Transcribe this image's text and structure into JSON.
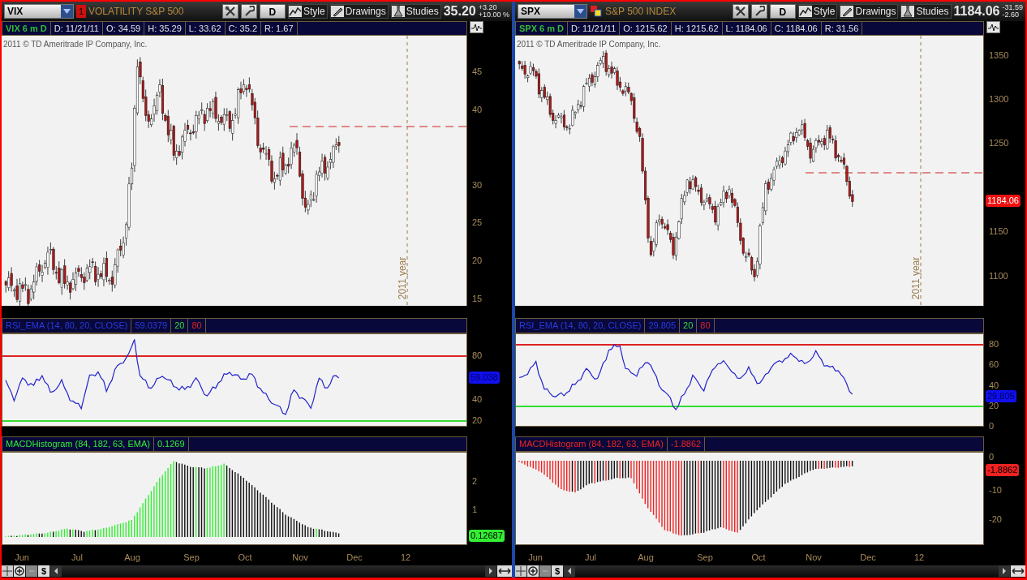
{
  "panels": [
    {
      "symbol": "VIX",
      "alert_count": "1",
      "description": "VOLATILITY S&P 500",
      "period": "D",
      "toolbar_buttons": [
        "Style",
        "Drawings",
        "Studies"
      ],
      "last": "35.20",
      "change": "+3.20",
      "change_pct": "+10.00 %",
      "info": {
        "title": "VIX 6 m D",
        "fields": [
          "D: 11/21/11",
          "O: 34.59",
          "H: 35.29",
          "L: 33.62",
          "C: 35.2",
          "R: 1.67"
        ]
      },
      "copyright": "2011 © TD Ameritrade IP Company, Inc.",
      "year_marker": "2011 year",
      "price_axis": [
        "45",
        "40",
        "30",
        "25",
        "20",
        "15"
      ],
      "rsi": {
        "title": "RSI_EMA (14, 80, 20, CLOSE)",
        "value": "59.0379",
        "levels": [
          {
            "label": "20",
            "color": "#33dd33"
          },
          {
            "label": "80",
            "color": "#dd2222"
          }
        ],
        "axis": [
          "80",
          "40",
          "20"
        ],
        "badge": "59.038"
      },
      "macd": {
        "title": "MACDHistogram (84, 182, 63, EMA)",
        "value": "0.1269",
        "color": "#33ee33",
        "axis": [
          "2",
          "1"
        ],
        "badge": "0.12687"
      },
      "months": [
        "Jun",
        "Jul",
        "Aug",
        "Sep",
        "Oct",
        "Nov",
        "Dec",
        "12"
      ],
      "currency_button": "$"
    },
    {
      "symbol": "SPX",
      "description": "S&P 500 INDEX",
      "period": "D",
      "toolbar_buttons": [
        "Style",
        "Drawings",
        "Studies"
      ],
      "last": "1184.06",
      "change": "-31.59",
      "change_pct": "-2.60",
      "info": {
        "title": "SPX 6 m D",
        "fields": [
          "D: 11/21/11",
          "O: 1215.62",
          "H: 1215.62",
          "L: 1184.06",
          "C: 1184.06",
          "R: 31.56"
        ]
      },
      "copyright": "2011 © TD Ameritrade IP Company, Inc.",
      "year_marker": "2011 year",
      "price_axis": [
        "1350",
        "1300",
        "1250",
        "1150",
        "1100"
      ],
      "price_badge": "1184.06",
      "rsi": {
        "title": "RSI_EMA (14, 80, 20, CLOSE)",
        "value": "29.805",
        "levels": [
          {
            "label": "20",
            "color": "#33dd33"
          },
          {
            "label": "80",
            "color": "#dd2222"
          }
        ],
        "axis": [
          "80",
          "60",
          "40",
          "20",
          "0"
        ],
        "badge": "29.805"
      },
      "macd": {
        "title": "MACDHistogram (84, 182, 63, EMA)",
        "value": "-1.8862",
        "color": "#ee2222",
        "axis": [
          "0",
          "-10",
          "-20"
        ],
        "badge": "-1.8862"
      },
      "months": [
        "Jun",
        "Jul",
        "Aug",
        "Sep",
        "Oct",
        "Nov",
        "Dec",
        "12"
      ],
      "currency_button": "$"
    }
  ]
}
